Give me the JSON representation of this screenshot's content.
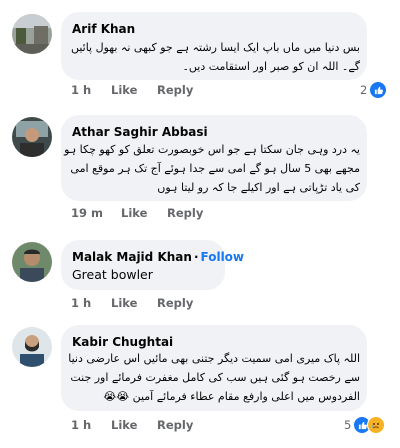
{
  "comments": [
    {
      "name": "Arif Khan",
      "text_lines": [
        "بس دنیا میں ماں باپ ایک ایسا رشتہ ہے جو کبھی نہ بھول پائیں",
        "گے۔ اللہ ان کو صبر اور استقامت دیں۔"
      ],
      "time": "1 h",
      "like_label": "Like",
      "reply_label": "Reply",
      "reaction_count": "2"
    },
    {
      "name": "Athar Saghir Abbasi",
      "text_lines": [
        "یہ درد وہی جان سکتا ہے جو اس خوبصورت تعلق کو کھو چکا ہو",
        "مجھے بھی 5 سال ہو گے امی سے جدا ہوئے آج تک ہر موقع امی",
        "کی یاد تڑپاتی ہے اور اکیلے جا کہ رو لیتا ہوں"
      ],
      "time": "19 m",
      "like_label": "Like",
      "reply_label": "Reply"
    },
    {
      "name": "Malak Majid Khan",
      "follow_label": "Follow",
      "text": "Great bowler",
      "time": "1 h",
      "like_label": "Like",
      "reply_label": "Reply"
    },
    {
      "name": "Kabir Chughtai",
      "text_lines": [
        "اللہ پاک میری امی سمیت دیگر جتنی بھی مائیں اس عارضی دنیا",
        "سے رخصت ہو گئی ہیں سب کی کامل مغفرت فرمائے اور جنت",
        "الفردوس میں اعلی وارفع مقام عطاء فرمائے آمین 😭😭"
      ],
      "time": "1 h",
      "like_label": "Like",
      "reply_label": "Reply",
      "reaction_count": "5"
    }
  ],
  "colors": {
    "bubble": "#f0f2f5",
    "meta": "#65676b",
    "accent": "#1877f2"
  },
  "icons": [
    "like-icon",
    "crying-emoji-icon"
  ]
}
